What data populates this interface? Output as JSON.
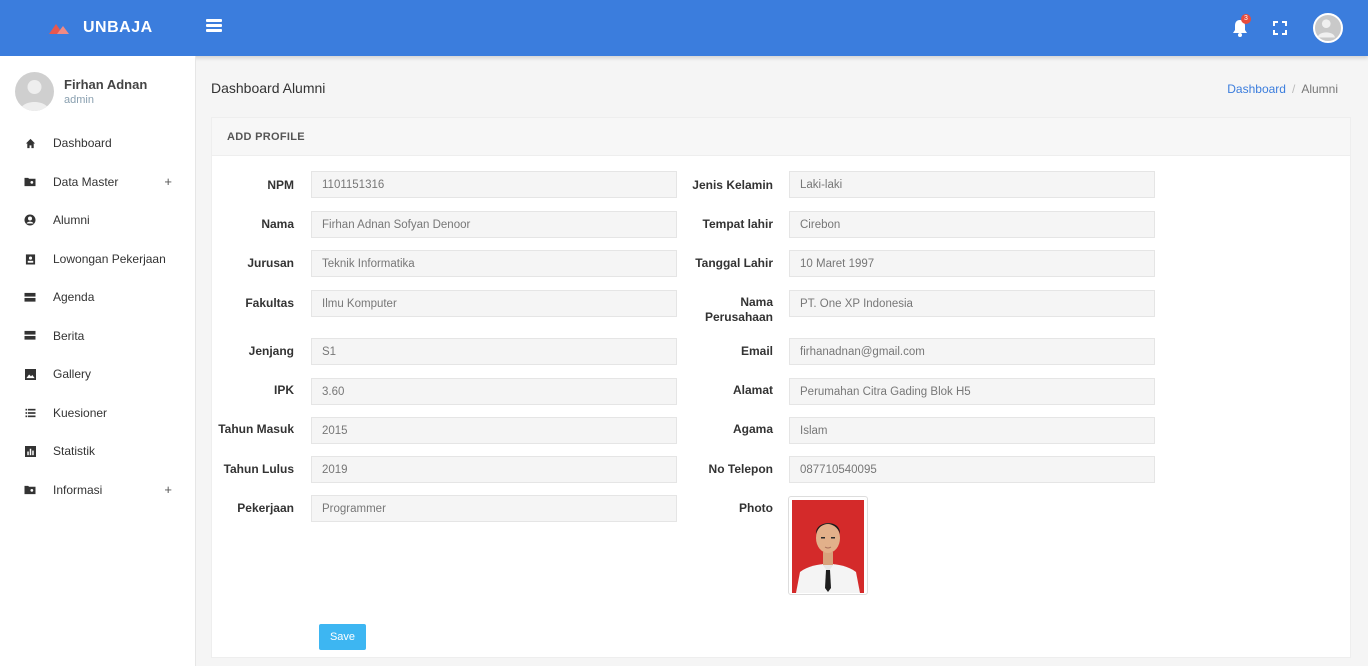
{
  "brand": {
    "name": "UNBAJA",
    "logo_icon": "mountain-logo-icon",
    "accent": "#e8574e"
  },
  "topbar": {
    "notification_count": "3",
    "colors": {
      "bar": "#3b7ddd"
    }
  },
  "sidebar": {
    "user_name": "Firhan Adnan",
    "user_role": "admin",
    "items": [
      {
        "label": "Dashboard",
        "icon": "home-icon",
        "expandable": false
      },
      {
        "label": "Data Master",
        "icon": "folder-icon",
        "expandable": true,
        "expand_symbol": "+"
      },
      {
        "label": "Alumni",
        "icon": "user-circle-icon",
        "expandable": false
      },
      {
        "label": "Lowongan Pekerjaan",
        "icon": "id-badge-icon",
        "expandable": false
      },
      {
        "label": "Agenda",
        "icon": "server-icon",
        "expandable": false
      },
      {
        "label": "Berita",
        "icon": "server-icon",
        "expandable": false
      },
      {
        "label": "Gallery",
        "icon": "image-icon",
        "expandable": false
      },
      {
        "label": "Kuesioner",
        "icon": "list-icon",
        "expandable": false
      },
      {
        "label": "Statistik",
        "icon": "chart-icon",
        "expandable": false
      },
      {
        "label": "Informasi",
        "icon": "folder-icon",
        "expandable": true,
        "expand_symbol": "+"
      }
    ]
  },
  "page": {
    "title": "Dashboard Alumni",
    "breadcrumb": {
      "home": "Dashboard",
      "separator": "/",
      "current": "Alumni"
    }
  },
  "form": {
    "header": "ADD PROFILE",
    "left": [
      {
        "label": "NPM",
        "value": "1101151316"
      },
      {
        "label": "Nama",
        "value": "Firhan Adnan Sofyan Denoor"
      },
      {
        "label": "Jurusan",
        "value": "Teknik Informatika"
      },
      {
        "label": "Fakultas",
        "value": "Ilmu Komputer"
      },
      {
        "label": "Jenjang",
        "value": "S1"
      },
      {
        "label": "IPK",
        "value": "3.60"
      },
      {
        "label": "Tahun Masuk",
        "value": "2015"
      },
      {
        "label": "Tahun Lulus",
        "value": "2019"
      },
      {
        "label": "Pekerjaan",
        "value": "Programmer"
      }
    ],
    "right": [
      {
        "label": "Jenis Kelamin",
        "value": "Laki-laki"
      },
      {
        "label": "Tempat lahir",
        "value": "Cirebon"
      },
      {
        "label": "Tanggal Lahir",
        "value": "10 Maret 1997"
      },
      {
        "label": "Nama Perusahaan",
        "value": "PT. One XP Indonesia"
      },
      {
        "label": "Email",
        "value": "firhanadnan@gmail.com"
      },
      {
        "label": "Alamat",
        "value": "Perumahan Citra Gading Blok H5"
      },
      {
        "label": "Agama",
        "value": "Islam"
      },
      {
        "label": "No Telepon",
        "value": "087710540095"
      },
      {
        "label": "Photo",
        "value": ""
      }
    ],
    "save_label": "Save",
    "colors": {
      "save_button": "#3db6f2",
      "photo_background": "#d42a2a"
    }
  }
}
